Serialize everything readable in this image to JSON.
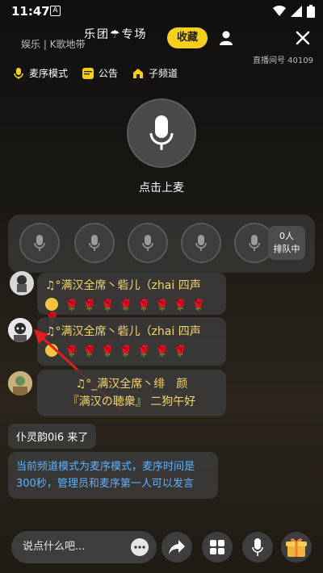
{
  "status_bar": {
    "time": "11:47",
    "app_badge": "A"
  },
  "header": {
    "title": "乐团☂专场",
    "subtitle": "娱乐 | K歌地带",
    "favorite_label": "收藏",
    "room_id": "直播间号 40109"
  },
  "tabs": [
    {
      "label": "麦序模式",
      "icon": "mic-mode-icon"
    },
    {
      "label": "公告",
      "icon": "notice-icon"
    },
    {
      "label": "子频道",
      "icon": "home-icon"
    }
  ],
  "mic": {
    "label": "点击上麦"
  },
  "queue": {
    "count": "0人",
    "label": "排队中"
  },
  "messages": [
    {
      "text": "♫°满汉全席丶砦儿（zhai 四声",
      "roses": "🌹🌹🌹🌹🌹🌹🌹🌹🌹"
    },
    {
      "text": "♫°满汉全席丶砦儿（zhai 四声",
      "roses": "🌹🌹🌹🌹🌹🌹🌹"
    },
    {
      "line1": "♫°_满汉全席丶绯　颜",
      "line2": "『满汉の聴衆』 二狗午好"
    }
  ],
  "join_message": "仆灵韵0i6 来了",
  "system_message": "当前频道模式为麦序模式，麦序时间是300秒，管理员和麦序第一人可以发言",
  "input": {
    "placeholder": "说点什么吧..."
  },
  "colors": {
    "accent": "#f5cf1c",
    "message_gold": "#f3d56b",
    "system_blue": "#5eb1ff",
    "rose_red": "#e53939"
  }
}
